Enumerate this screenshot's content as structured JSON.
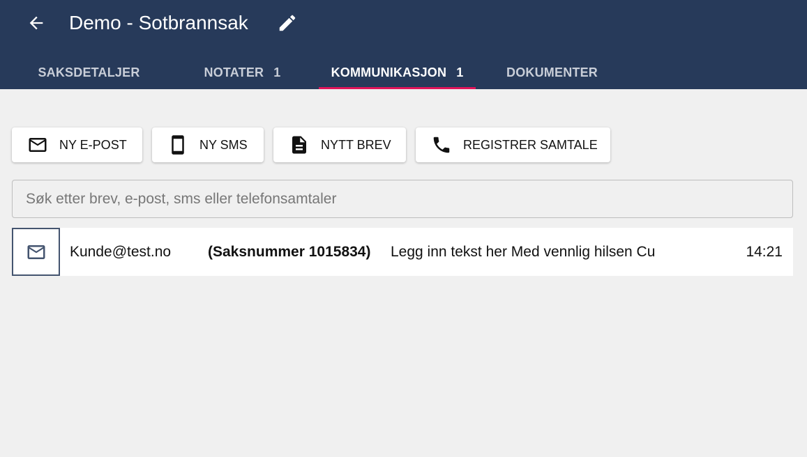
{
  "header": {
    "title": "Demo - Sotbrannsak",
    "back_icon": "arrow-left-icon",
    "edit_icon": "pencil-icon",
    "background_color": "#273a5a"
  },
  "tabs": [
    {
      "label": "SAKSDETALJER",
      "count": "",
      "active": false
    },
    {
      "label": "NOTATER",
      "count": "1",
      "active": false
    },
    {
      "label": "KOMMUNIKASJON",
      "count": "1",
      "active": true
    },
    {
      "label": "DOKUMENTER",
      "count": "",
      "active": false
    }
  ],
  "tab_indicator_color": "#e0145a",
  "actions": [
    {
      "label": "NY E-POST",
      "icon": "email-icon"
    },
    {
      "label": "NY SMS",
      "icon": "smartphone-icon"
    },
    {
      "label": "NYTT BREV",
      "icon": "document-icon"
    },
    {
      "label": "REGISTRER SAMTALE",
      "icon": "phone-icon"
    }
  ],
  "search": {
    "placeholder": "Søk etter brev, e-post, sms eller telefonsamtaler",
    "value": ""
  },
  "messages": [
    {
      "type_icon": "email-icon",
      "from": "Kunde@test.no",
      "subject": "(Saksnummer 1015834)",
      "preview": "Legg inn tekst her Med vennlig hilsen Cu",
      "time": "14:21"
    }
  ]
}
